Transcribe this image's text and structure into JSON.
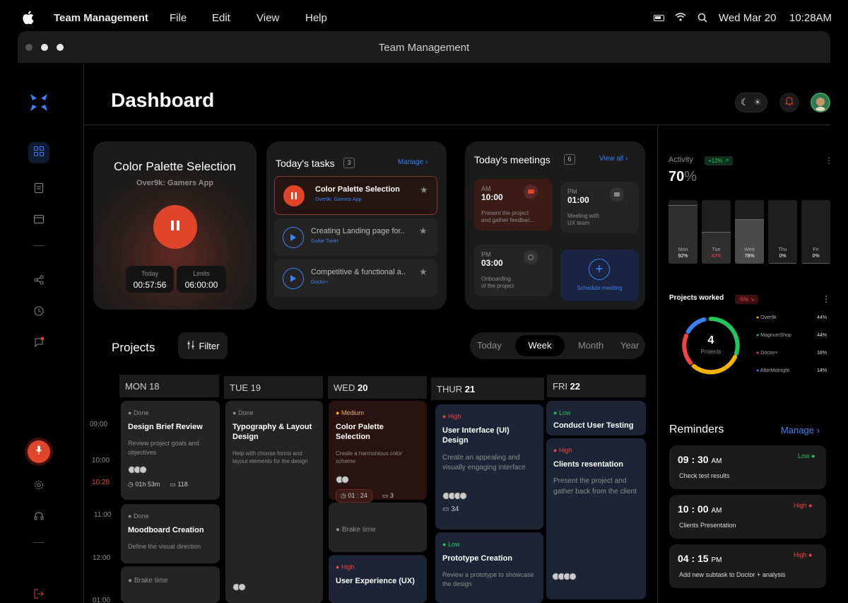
{
  "menubar": {
    "app_name": "Team Management",
    "items": [
      "File",
      "Edit",
      "View",
      "Help"
    ],
    "date": "Wed Mar 20",
    "time": "10:28AM"
  },
  "window": {
    "title": "Team Management"
  },
  "header": {
    "title": "Dashboard"
  },
  "current_task": {
    "title": "Color Palette Selection",
    "subtitle": "Over9k: Gamers App",
    "today_label": "Today",
    "today_value": "00:57:56",
    "limits_label": "Limits",
    "limits_value": "06:00:00"
  },
  "tasks": {
    "title": "Today's tasks",
    "count": "3",
    "manage_label": "Manage",
    "items": [
      {
        "title": "Color Palette Selection",
        "project": "Over9k: Gamers App"
      },
      {
        "title": "Creating Landing page for..",
        "project": "Guitar Tuner"
      },
      {
        "title": "Competitive & functional a..",
        "project": "Doctor+"
      }
    ]
  },
  "meetings": {
    "title": "Today's meetings",
    "count": "6",
    "view_all_label": "View all",
    "items": [
      {
        "period": "AM",
        "time": "10:00",
        "desc1": "Present the project",
        "desc2": "and gather feedbac..."
      },
      {
        "period": "PM",
        "time": "01:00",
        "desc1": "Meeting with",
        "desc2": "UX team"
      },
      {
        "period": "PM",
        "time": "03:00",
        "desc1": "Onboarding",
        "desc2": "of the project"
      }
    ],
    "schedule_label": "Schedule meeting"
  },
  "projects": {
    "title": "Projects",
    "filter_label": "Filter",
    "ranges": [
      "Today",
      "Week",
      "Month",
      "Year"
    ],
    "active_range": "Week",
    "times": [
      "09:00",
      "10:00",
      "10:28",
      "11:00",
      "12:00",
      "01:00"
    ],
    "columns": [
      {
        "day": "MON",
        "date": "18"
      },
      {
        "day": "TUE",
        "date": "19"
      },
      {
        "day": "WED",
        "date": "20"
      },
      {
        "day": "THUR",
        "date": "21"
      },
      {
        "day": "FRI",
        "date": "22"
      }
    ],
    "cards": {
      "mon1": {
        "tag": "Done",
        "title": "Design Brief Review",
        "desc": "Review project goals and objectives",
        "time": "01h 53m",
        "comments": "118"
      },
      "mon2": {
        "tag": "Done",
        "title": "Moodboard Creation",
        "desc": "Define the visual direction"
      },
      "mon3": {
        "label": "Brake time"
      },
      "tue1": {
        "tag": "Done",
        "title": "Typography & Layout Design",
        "desc": "Help with  choose forms and layout elements for the design"
      },
      "wed1": {
        "tag": "Medium",
        "title": "Color Palette Selection",
        "desc": "Create a harmonious color scheme",
        "timer": "01 : 24",
        "comments": "3"
      },
      "wed2": {
        "label": "Brake time"
      },
      "wed3": {
        "tag": "High",
        "title": "User Experience (UX)"
      },
      "thu1": {
        "tag": "High",
        "title": "User Interface (UI) Design",
        "desc": "Create an appealing and visually engaging interface",
        "comments": "34"
      },
      "thu2": {
        "tag": "Low",
        "title": "Prototype Creation",
        "desc": "Review a prototype to showcase the design"
      },
      "fri1": {
        "tag": "Low",
        "title": "Conduct User Testing"
      },
      "fri2": {
        "tag": "High",
        "title": "Clients resentation",
        "desc": "Present the project and gather back from the client"
      }
    }
  },
  "activity": {
    "title": "Activity",
    "change": "+12%",
    "value": "70",
    "unit": "%",
    "bars": [
      {
        "day": "Mon",
        "pct": "92%",
        "level": 0.92,
        "color": "#2f2f2f"
      },
      {
        "day": "Tue",
        "pct": "42%",
        "level": 0.5,
        "color": "#2f2f2f"
      },
      {
        "day": "Wed",
        "pct": "78%",
        "level": 0.7,
        "color": "#4a4a4a"
      },
      {
        "day": "Thu",
        "pct": "0%",
        "level": 0.0,
        "color": "#2f2f2f"
      },
      {
        "day": "Fri",
        "pct": "0%",
        "level": 0.0,
        "color": "#2f2f2f"
      }
    ]
  },
  "projects_worked": {
    "title": "Projects worked",
    "change": "-5%",
    "count": "4",
    "count_label": "Projects",
    "items": [
      {
        "name": "Over9k",
        "pct": "44%",
        "color": "#f5b400"
      },
      {
        "name": "MagnumShop",
        "pct": "44%",
        "color": "#22c55e"
      },
      {
        "name": "Doctor+",
        "pct": "18%",
        "color": "#ef4444"
      },
      {
        "name": "AfterMidnight",
        "pct": "14%",
        "color": "#3b82f6"
      }
    ]
  },
  "reminders": {
    "title": "Reminders",
    "manage_label": "Manage",
    "items": [
      {
        "time": "09 : 30",
        "period": "AM",
        "priority": "Low",
        "text": "Check  test results",
        "color": "#22c55e"
      },
      {
        "time": "10 : 00",
        "period": "AM",
        "priority": "High",
        "text": "Clients Presentation",
        "color": "#ef4444"
      },
      {
        "time": "04 : 15",
        "period": "PM",
        "priority": "High",
        "text": "Add new subtask to Doctor + analysis",
        "color": "#ef4444"
      }
    ]
  },
  "colors": {
    "accent": "#3b82f6",
    "danger": "#e0452b",
    "high": "#ef4444",
    "low": "#22c55e",
    "medium": "#f5b400"
  }
}
